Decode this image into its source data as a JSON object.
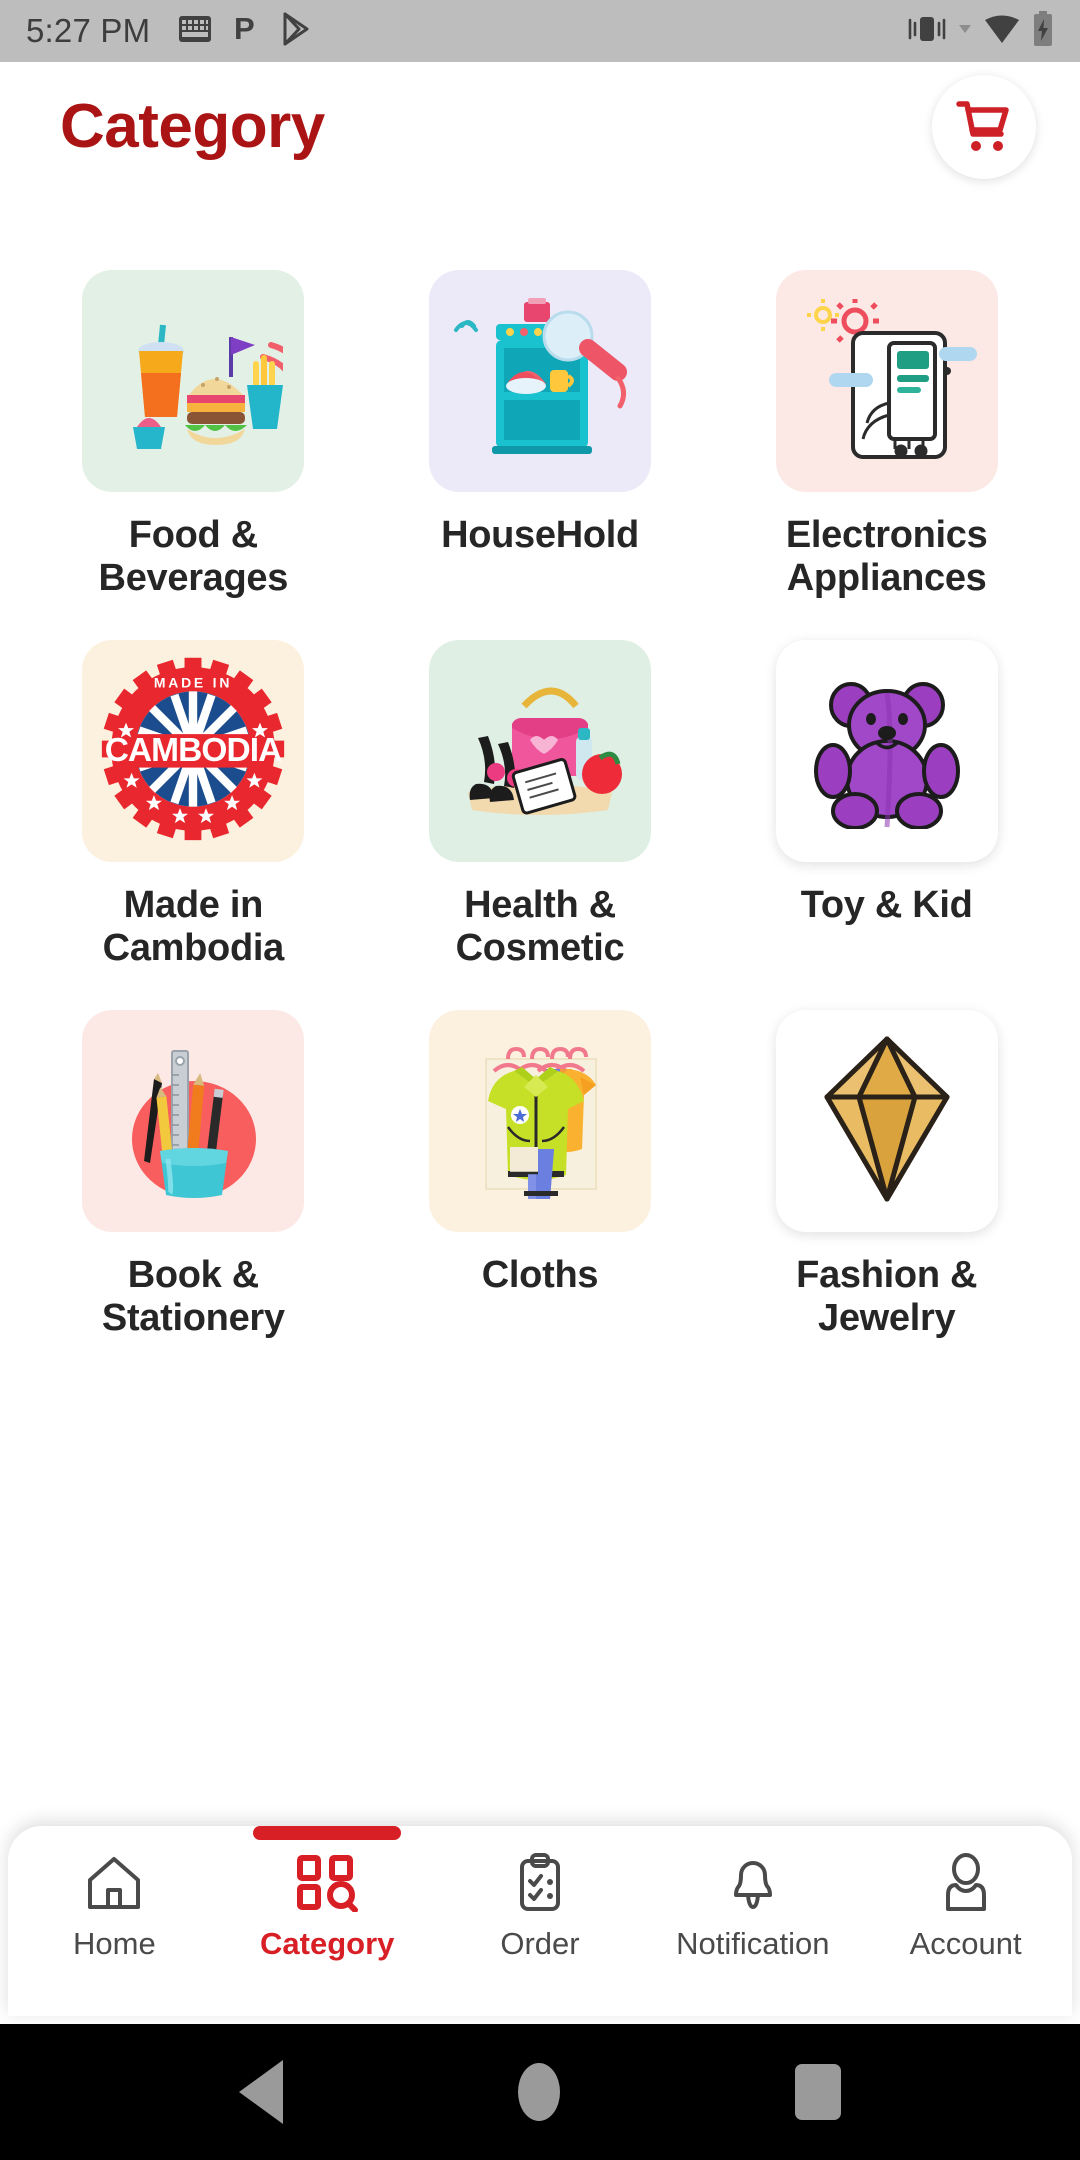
{
  "statusbar": {
    "time": "5:27 PM",
    "left_icons": [
      "keyboard-icon",
      "parking-p-icon",
      "play-store-icon"
    ],
    "right_icons": [
      "vibrate-icon",
      "dropdown-caret-icon",
      "wifi-icon",
      "battery-charging-icon"
    ]
  },
  "header": {
    "title": "Category",
    "cart_icon": "shopping-cart-icon",
    "title_color": "#AB1414"
  },
  "categories": [
    {
      "label": "Food & Beverages",
      "tile_bg": "#E3F0E6",
      "icon": "food-beverages-illustration",
      "shadow": false
    },
    {
      "label": "HouseHold",
      "tile_bg": "#ECE9F8",
      "icon": "household-illustration",
      "shadow": false
    },
    {
      "label": "Electronics Appliances",
      "tile_bg": "#FCE9E6",
      "icon": "electronics-illustration",
      "shadow": false
    },
    {
      "label": "Made in Cambodia",
      "tile_bg": "#FBF1DE",
      "icon": "made-in-cambodia-badge",
      "shadow": false
    },
    {
      "label": "Health & Cosmetic",
      "tile_bg": "#DFEFE4",
      "icon": "health-cosmetic-illustration",
      "shadow": false
    },
    {
      "label": "Toy & Kid",
      "tile_bg": "#FFFFFF",
      "icon": "teddy-bear-illustration",
      "shadow": true
    },
    {
      "label": "Book & Stationery",
      "tile_bg": "#FCE9E6",
      "icon": "stationery-illustration",
      "shadow": false
    },
    {
      "label": "Cloths",
      "tile_bg": "#FBF1DE",
      "icon": "clothes-illustration",
      "shadow": false
    },
    {
      "label": "Fashion & Jewelry",
      "tile_bg": "#FFFFFF",
      "icon": "diamond-illustration",
      "shadow": true
    }
  ],
  "peek_row": [
    {
      "tile_bg": "#FFFFFF"
    },
    {
      "tile_bg": "#FFFFFF"
    },
    {
      "tile_bg": "#FBF1DE"
    }
  ],
  "bottom_nav": {
    "active_color": "#D81F26",
    "inactive_color": "#4a4a4a",
    "items": [
      {
        "label": "Home",
        "icon": "home-icon",
        "active": false
      },
      {
        "label": "Category",
        "icon": "grid-search-icon",
        "active": true
      },
      {
        "label": "Order",
        "icon": "clipboard-icon",
        "active": false
      },
      {
        "label": "Notification",
        "icon": "bell-icon",
        "active": false
      },
      {
        "label": "Account",
        "icon": "person-icon",
        "active": false
      }
    ]
  },
  "android_nav": {
    "buttons": [
      "back-button",
      "home-button",
      "recents-button"
    ]
  }
}
